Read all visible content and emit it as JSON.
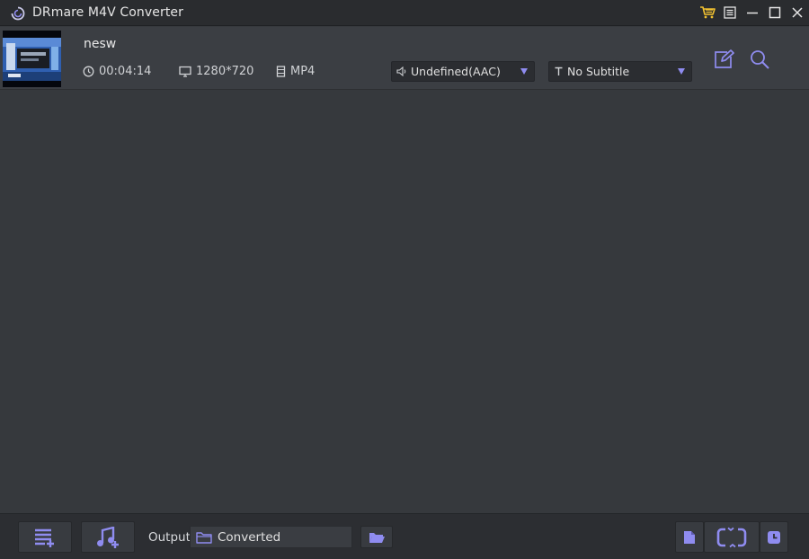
{
  "window": {
    "title": "DRmare M4V Converter",
    "accent_color": "#8f8cf0",
    "cart_color": "#f2c230"
  },
  "file": {
    "name": "nesw",
    "duration": "00:04:14",
    "resolution": "1280*720",
    "format": "MP4",
    "audio_track": "Undefined(AAC)",
    "subtitle": "No Subtitle"
  },
  "bottom": {
    "output_label": "Output:",
    "output_path": "Converted"
  }
}
